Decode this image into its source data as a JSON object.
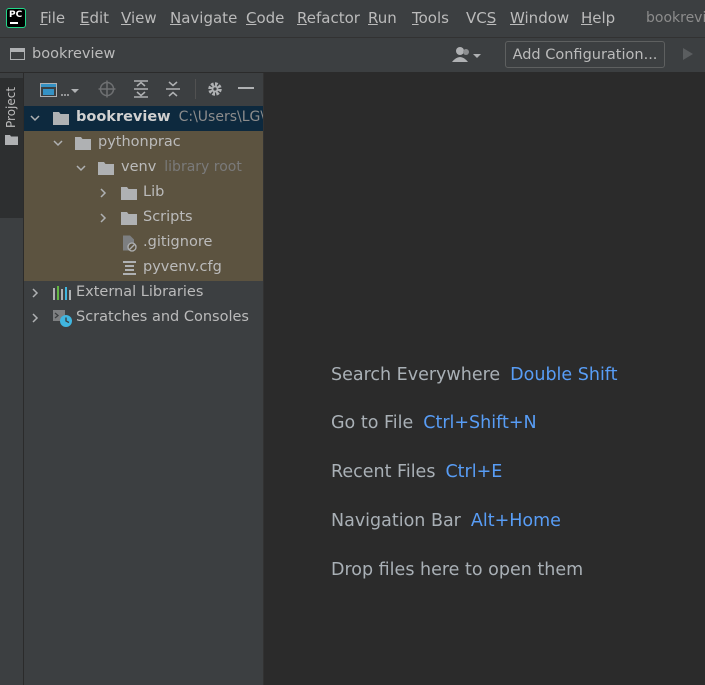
{
  "app": {
    "logo_text": "PC",
    "window_title": "bookrevi"
  },
  "menu": [
    {
      "mnemonic": "F",
      "rest": "ile"
    },
    {
      "mnemonic": "E",
      "rest": "dit"
    },
    {
      "mnemonic": "V",
      "rest": "iew"
    },
    {
      "mnemonic": "N",
      "rest": "avigate"
    },
    {
      "mnemonic": "C",
      "rest": "ode"
    },
    {
      "mnemonic": "R",
      "rest": "efactor"
    },
    {
      "mnemonic": "R",
      "rest": "un"
    },
    {
      "mnemonic": "T",
      "rest": "ools"
    },
    {
      "pre": "VC",
      "mnemonic": "S",
      "rest": ""
    },
    {
      "mnemonic": "W",
      "rest": "indow"
    },
    {
      "mnemonic": "H",
      "rest": "elp"
    }
  ],
  "navbar": {
    "project_name": "bookreview",
    "add_configuration": "Add Configuration..."
  },
  "tool_window": {
    "tab_label": "Project"
  },
  "tree": {
    "root": {
      "label": "bookreview",
      "path": "C:\\Users\\LG\\"
    },
    "pythonprac": "pythonprac",
    "venv": {
      "label": "venv",
      "hint": "library root"
    },
    "lib": "Lib",
    "scripts": "Scripts",
    "gitignore": ".gitignore",
    "pyvenv": "pyvenv.cfg",
    "external_libraries": "External Libraries",
    "scratches": "Scratches and Consoles"
  },
  "editor_hints": [
    {
      "label": "Search Everywhere",
      "shortcut": "Double Shift"
    },
    {
      "label": "Go to File",
      "shortcut": "Ctrl+Shift+N"
    },
    {
      "label": "Recent Files",
      "shortcut": "Ctrl+E"
    },
    {
      "label": "Navigation Bar",
      "shortcut": "Alt+Home"
    },
    {
      "label": "Drop files here to open them",
      "shortcut": ""
    }
  ],
  "colors": {
    "background": "#2b2b2b",
    "panel": "#3c3f41",
    "selection": "#0d293e",
    "library_root_highlight": "#5c5340",
    "shortcut": "#589df6",
    "logo_accent": "#21d789"
  }
}
